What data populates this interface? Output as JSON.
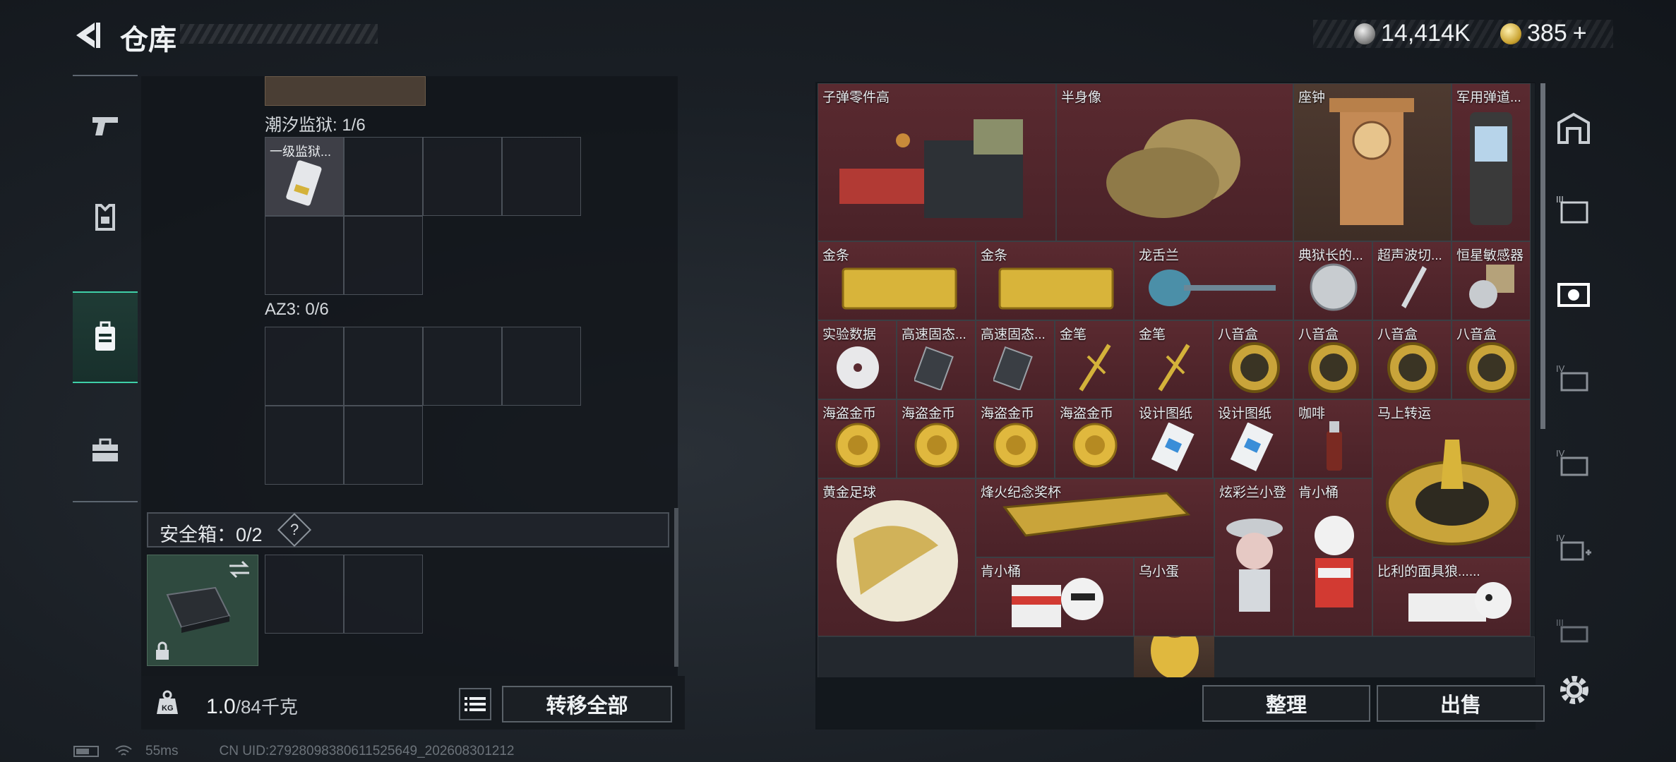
{
  "header": {
    "title": "仓库",
    "silver": "14,414K",
    "gold": "385",
    "gold_plus": "+"
  },
  "left_nav": [
    "gun-icon",
    "armor-icon",
    "backpack-icon",
    "toolbox-icon"
  ],
  "containers": [
    {
      "label": "潮汐监狱: 1/6",
      "item": "一级监狱..."
    },
    {
      "label": "AZ3: 0/6"
    }
  ],
  "safe": {
    "label": "安全箱：0/2",
    "help": "?"
  },
  "weight": {
    "value": "1.0",
    "unit": "/84千克"
  },
  "buttons": {
    "transfer_all": "转移全部",
    "sort": "整理",
    "sell": "出售"
  },
  "items": [
    "子弹零件高",
    "半身像",
    "座钟",
    "军用弹道...",
    "金条",
    "金条",
    "龙舌兰",
    "典狱长的...",
    "超声波切...",
    "恒星敏感器",
    "实验数据",
    "高速固态...",
    "高速固态...",
    "金笔",
    "金笔",
    "八音盒",
    "八音盒",
    "八音盒",
    "八音盒",
    "海盗金币",
    "海盗金币",
    "海盗金币",
    "海盗金币",
    "设计图纸",
    "设计图纸",
    "咖啡",
    "马上转运",
    "黄金足球",
    "烽火纪念奖杯",
    "炫彩兰小登",
    "肯小桶",
    "肯小桶",
    "乌小蛋",
    "比利的面具狼......"
  ],
  "colors": {
    "accent": "#3fd0a8",
    "rare_red": "#5a2a30",
    "rare_brown": "#4e3a30"
  },
  "status": {
    "ping": "55ms",
    "uid": "CN UID:27928098380611525649_202608301212"
  }
}
